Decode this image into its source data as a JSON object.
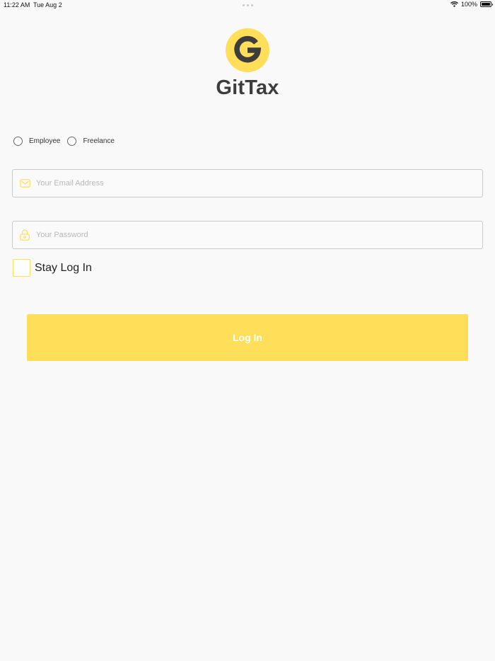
{
  "status_bar": {
    "time": "11:22 AM",
    "date": "Tue Aug 2",
    "battery": "100%",
    "icons": [
      "wifi-icon",
      "battery-icon"
    ]
  },
  "brand": {
    "name": "GitTax",
    "logo_letter": "G",
    "logo_color": "#ffde59",
    "logo_letter_color": "#3d3d3d"
  },
  "role_options": [
    {
      "label": "Employee",
      "selected": false
    },
    {
      "label": "Freelance",
      "selected": false
    }
  ],
  "email_field": {
    "value": "",
    "placeholder": "Your Email Address",
    "icon": "envelope-icon"
  },
  "password_field": {
    "value": "",
    "placeholder": "Your Password",
    "icon": "lock-icon"
  },
  "stay_logged_in": {
    "label": "Stay Log In",
    "checked": false
  },
  "login_button": {
    "label": "Log In"
  },
  "colors": {
    "accent": "#ffde59",
    "background": "#f9f9f9",
    "text_dark": "#3d3d3d"
  }
}
